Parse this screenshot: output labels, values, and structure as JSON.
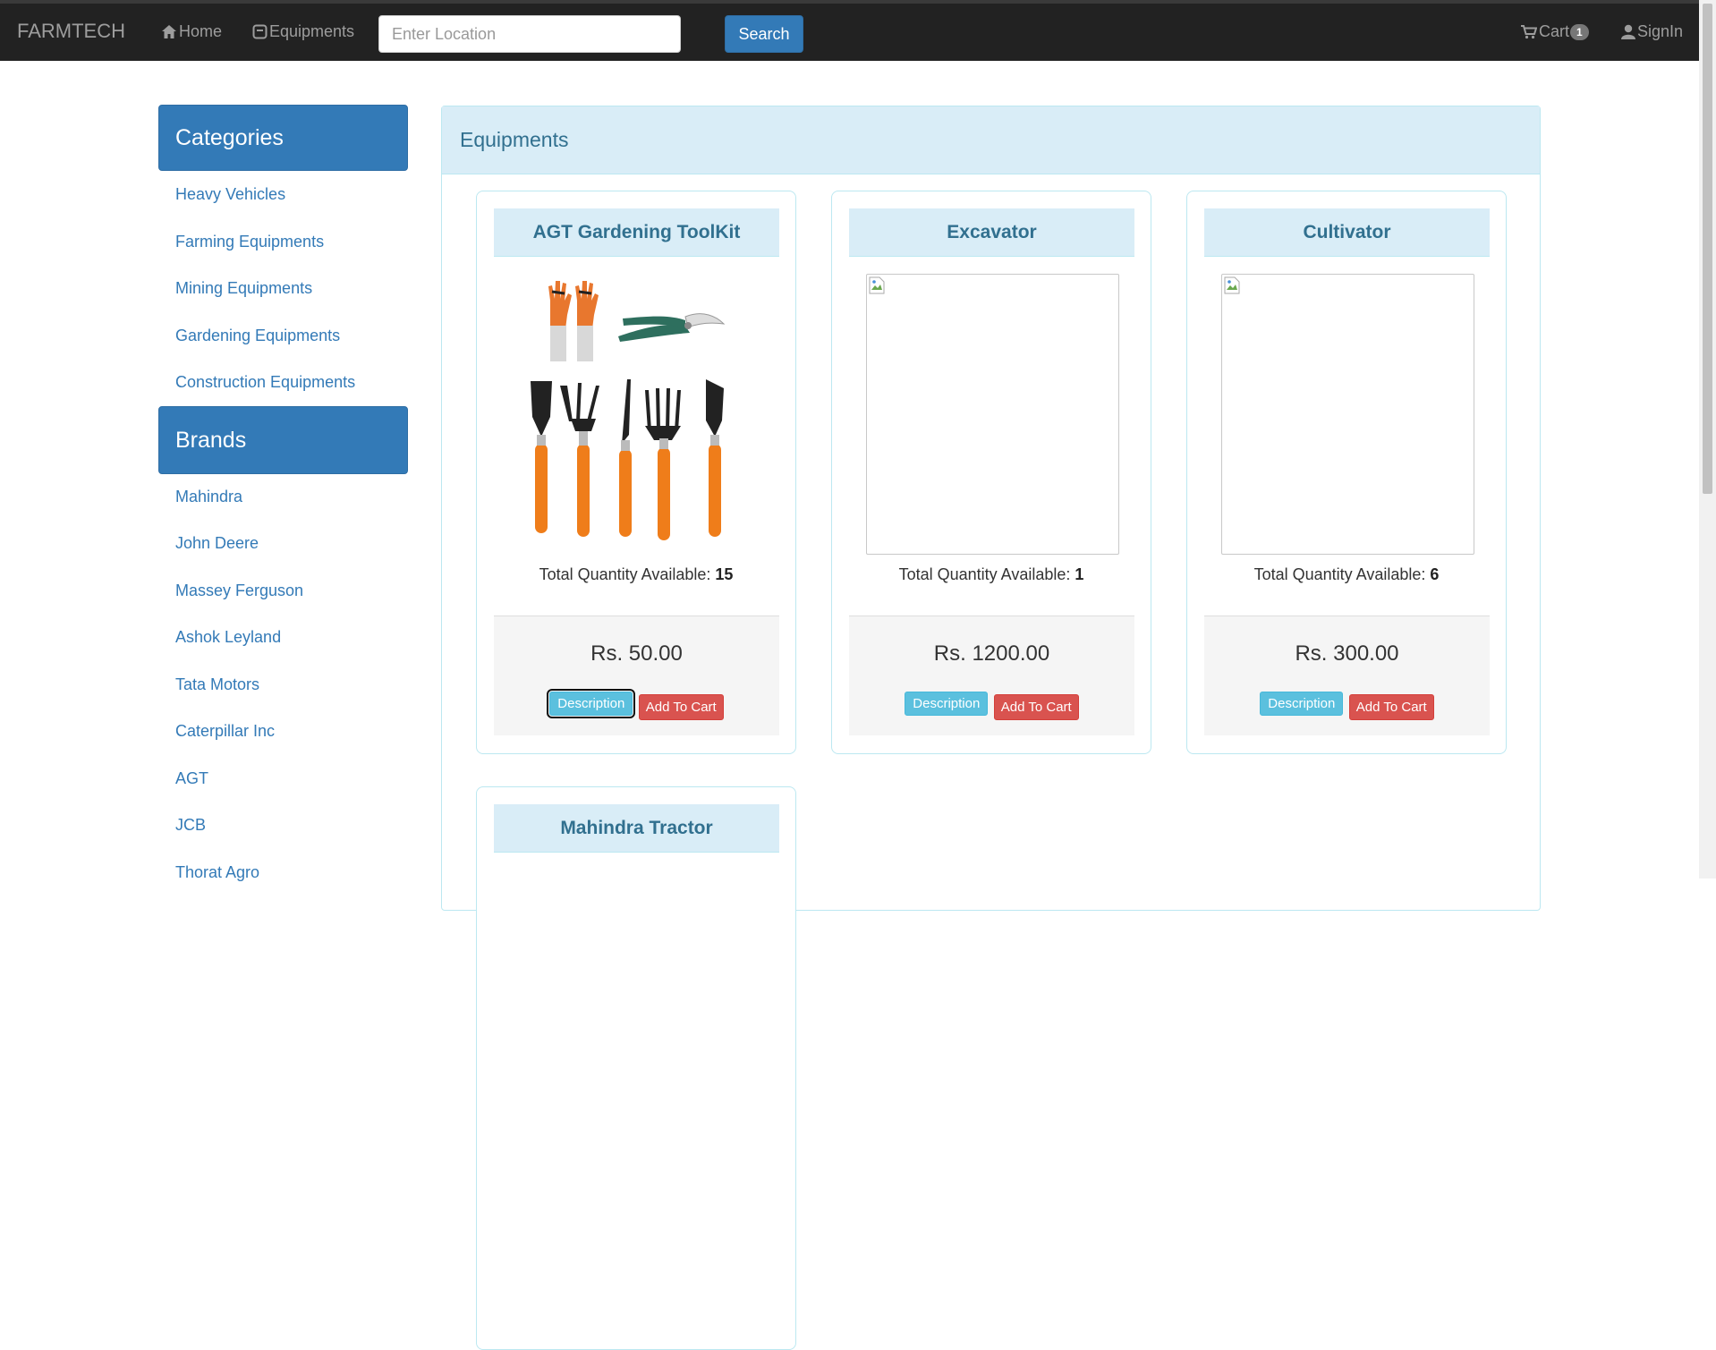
{
  "nav": {
    "brand": "FARMTECH",
    "home": "Home",
    "equipments": "Equipments",
    "search_placeholder": "Enter Location",
    "search_button": "Search",
    "cart": "Cart",
    "cart_count": "1",
    "signin": "SignIn"
  },
  "sidebar": {
    "categories_title": "Categories",
    "categories": [
      "Heavy Vehicles",
      "Farming Equipments",
      "Mining Equipments",
      "Gardening Equipments",
      "Construction Equipments"
    ],
    "brands_title": "Brands",
    "brands": [
      "Mahindra",
      "John Deere",
      "Massey Ferguson",
      "Ashok Leyland",
      "Tata Motors",
      "Caterpillar Inc",
      "AGT",
      "JCB",
      "Thorat Agro"
    ]
  },
  "main": {
    "title": "Equipments",
    "qty_label": "Total Quantity Available:",
    "description_label": "Description",
    "add_to_cart_label": "Add To Cart",
    "products": [
      {
        "name": "AGT Gardening ToolKit",
        "qty": "15",
        "price": "Rs. 50.00"
      },
      {
        "name": "Excavator",
        "qty": "1",
        "price": "Rs. 1200.00"
      },
      {
        "name": "Cultivator",
        "qty": "6",
        "price": "Rs. 300.00"
      },
      {
        "name": "Mahindra Tractor"
      }
    ]
  },
  "colors": {
    "primary": "#337ab7",
    "info": "#5bc0de",
    "danger": "#d9534f",
    "navbar": "#222222",
    "panel_head": "#d9edf7"
  }
}
